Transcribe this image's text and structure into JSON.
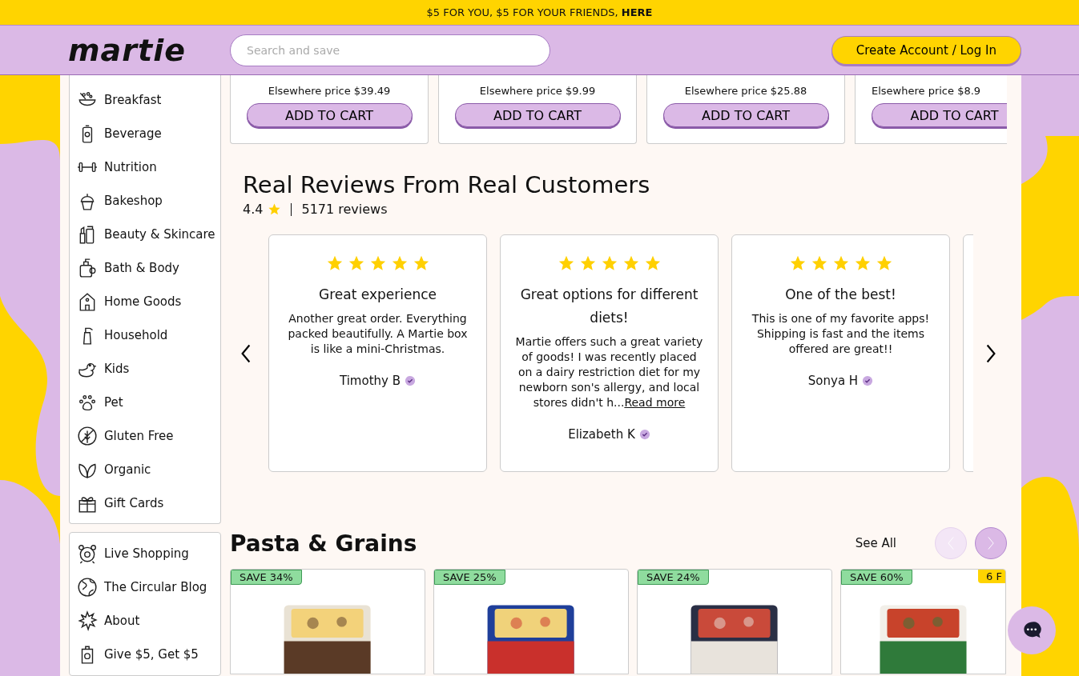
{
  "promo_banner": {
    "text": "$5 FOR YOU, $5 FOR YOUR FRIENDS, ",
    "link": "HERE"
  },
  "header": {
    "logo": "martie",
    "search": {
      "placeholder": "Search and save"
    },
    "account_button": "Create Account / Log In"
  },
  "sidebar": {
    "categories": [
      {
        "label": "Breakfast"
      },
      {
        "label": "Beverage"
      },
      {
        "label": "Nutrition"
      },
      {
        "label": "Bakeshop"
      },
      {
        "label": "Beauty & Skincare"
      },
      {
        "label": "Bath & Body"
      },
      {
        "label": "Home Goods"
      },
      {
        "label": "Household"
      },
      {
        "label": "Kids"
      },
      {
        "label": "Pet"
      },
      {
        "label": "Gluten Free"
      },
      {
        "label": "Organic"
      },
      {
        "label": "Gift Cards"
      }
    ],
    "links": [
      {
        "label": "Live Shopping"
      },
      {
        "label": "The Circular Blog"
      },
      {
        "label": "About"
      },
      {
        "label": "Give $5, Get $5"
      }
    ]
  },
  "top_products": [
    {
      "elsewhere_price": "Elsewhere price $39.49",
      "button": "ADD TO CART"
    },
    {
      "elsewhere_price": "Elsewhere price $9.99",
      "button": "ADD TO CART"
    },
    {
      "elsewhere_price": "Elsewhere price $25.88",
      "button": "ADD TO CART"
    },
    {
      "elsewhere_price": "Elsewhere price $8.9",
      "button": "ADD TO CART"
    }
  ],
  "reviews": {
    "title": "Real Reviews From Real Customers",
    "rating": "4.4",
    "count": "5171 reviews",
    "items": [
      {
        "stars": 5,
        "title": "Great experience",
        "body": "Another great order. Everything packed beautifully. A Martie box is like a mini-Christmas.",
        "author": "Timothy B"
      },
      {
        "stars": 5,
        "title": "Great options for different diets!",
        "body": "Martie offers such a great variety of goods! I was recently placed on a dairy restriction diet for my newborn son's allergy, and local stores didn't h...",
        "author": "Elizabeth K",
        "read_more": "Read more"
      },
      {
        "stars": 5,
        "title": "One of the best!",
        "body": "This is one of my favorite apps! Shipping is fast and the items offered are great!!",
        "author": "Sonya H"
      }
    ]
  },
  "pasta_section": {
    "title": "Pasta & Grains",
    "see_all": "See All",
    "prev_disabled": true,
    "products": [
      {
        "badge": "SAVE 34%"
      },
      {
        "badge": "SAVE 25%"
      },
      {
        "badge": "SAVE 24%"
      },
      {
        "badge": "SAVE 60%",
        "extra_badge": "6 F"
      }
    ]
  }
}
